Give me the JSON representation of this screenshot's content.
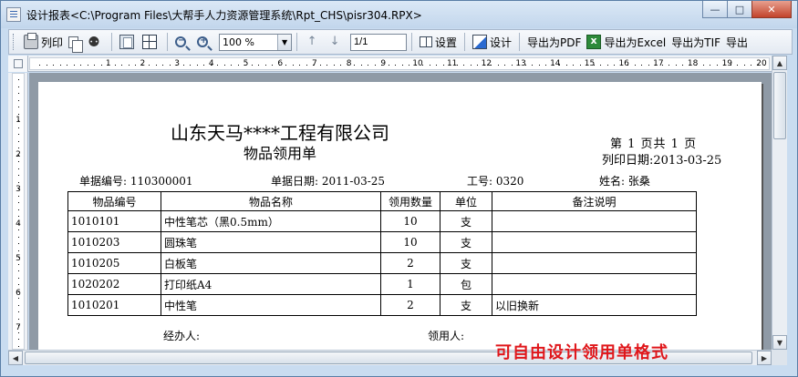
{
  "window": {
    "title": "设计报表<C:\\Program Files\\大帮手人力资源管理系统\\Rpt_CHS\\pisr304.RPX>",
    "minimize_glyph": "—",
    "maximize_glyph": "□",
    "close_glyph": "✕"
  },
  "toolbar": {
    "print_label": "列印",
    "find_glyph": "⚉",
    "zoom_value": "100 %",
    "page_value": "1/1",
    "setup_label": "设置",
    "design_label": "设计",
    "export_pdf_label": "导出为PDF",
    "export_excel_label": "导出为Excel",
    "export_tif_label": "导出为TIF",
    "export_label": "导出"
  },
  "ruler": {
    "horizontal": [
      "1",
      "2",
      "3",
      "4",
      "5",
      "6",
      "7",
      "8",
      "9",
      "10",
      "11",
      "12",
      "13",
      "14",
      "15",
      "16",
      "17",
      "18",
      "19",
      "20"
    ],
    "vertical": [
      "1",
      "2",
      "3",
      "4",
      "5",
      "6",
      "7"
    ]
  },
  "report": {
    "company": "山东天马****工程有限公司",
    "title": "物品领用单",
    "page_info": "第 1 页共 1 页",
    "print_date": "列印日期:2013-03-25",
    "fields": {
      "doc_no": "单据编号: 110300001",
      "doc_date": "单据日期: 2011-03-25",
      "employee_no": "工号: 0320",
      "name": "姓名: 张桑"
    },
    "table": {
      "headers": [
        "物品编号",
        "物品名称",
        "领用数量",
        "单位",
        "备注说明"
      ],
      "rows": [
        [
          "1010101",
          "中性笔芯（黑0.5mm）",
          "10",
          "支",
          ""
        ],
        [
          "1010203",
          "圆珠笔",
          "10",
          "支",
          ""
        ],
        [
          "1010205",
          "白板笔",
          "2",
          "支",
          ""
        ],
        [
          "1020202",
          "打印纸A4",
          "1",
          "包",
          ""
        ],
        [
          "1010201",
          "中性笔",
          "2",
          "支",
          "以旧换新"
        ]
      ]
    },
    "handler_label": "经办人:",
    "recipient_label": "领用人:"
  },
  "promo_text": "可自由设计领用单格式",
  "colors": {
    "promo": "#e0171b",
    "window_frame": "#c9dcf0"
  }
}
